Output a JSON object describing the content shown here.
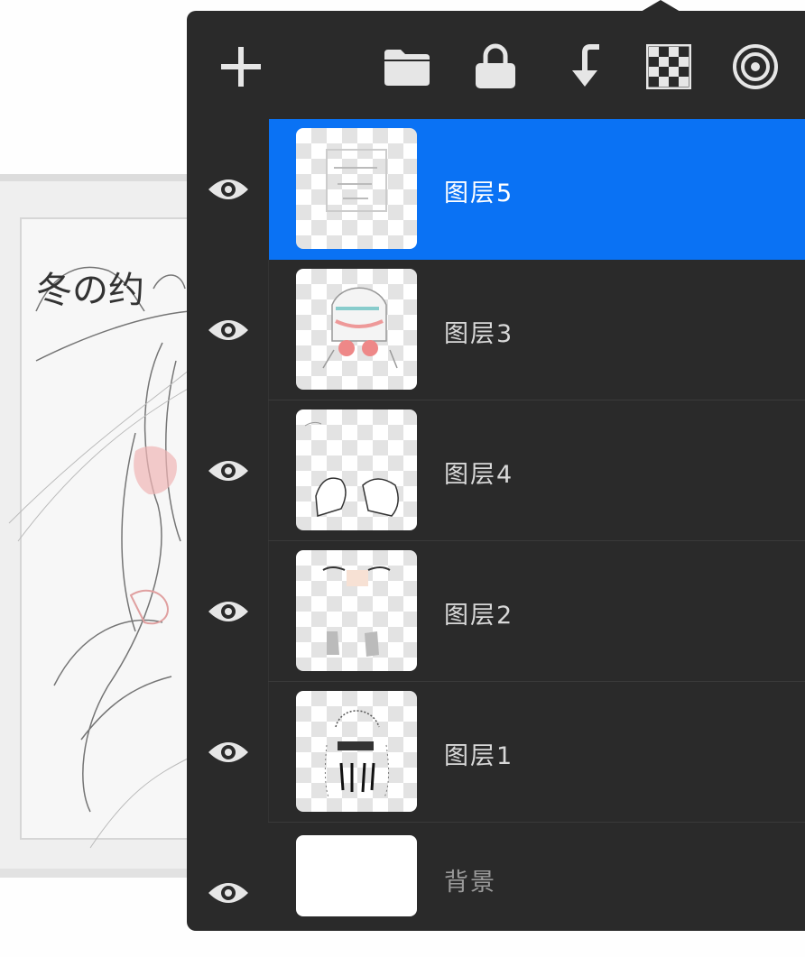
{
  "canvas": {
    "sketch_title": "冬の约"
  },
  "toolbar": {
    "tools": [
      {
        "name": "add-layer",
        "icon": "plus-icon"
      },
      {
        "name": "group",
        "icon": "folder-icon"
      },
      {
        "name": "lock",
        "icon": "lock-icon"
      },
      {
        "name": "merge-down",
        "icon": "arrow-down-left-icon"
      },
      {
        "name": "alpha-lock",
        "icon": "checkerboard-icon"
      },
      {
        "name": "reference",
        "icon": "target-icon"
      }
    ]
  },
  "layers": [
    {
      "name": "图层5",
      "visible": true,
      "selected": true
    },
    {
      "name": "图层3",
      "visible": true,
      "selected": false
    },
    {
      "name": "图层4",
      "visible": true,
      "selected": false
    },
    {
      "name": "图层2",
      "visible": true,
      "selected": false
    },
    {
      "name": "图层1",
      "visible": true,
      "selected": false
    },
    {
      "name": "背景",
      "visible": true,
      "selected": false
    }
  ],
  "colors": {
    "panel": "#2a2a2a",
    "selected": "#0a72f4",
    "icon": "#e6e6e6"
  }
}
